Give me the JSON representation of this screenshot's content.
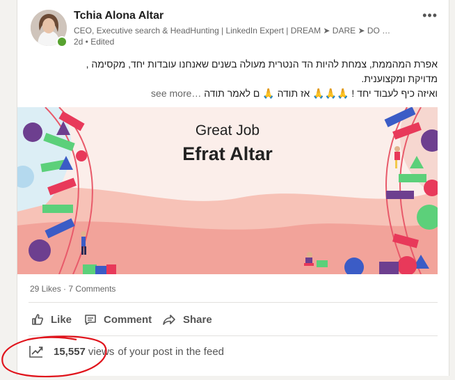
{
  "author": {
    "name": "Tchia Alona Altar",
    "headline": "CEO, Executive search & HeadHunting | LinkedIn Expert | DREAM ➤ DARE ➤ DO …",
    "meta": "2d • Edited"
  },
  "post": {
    "lines": [
      "אפרת המהממת, צמחת להיות הד הנטרית מעולה בשנים שאנחנו עובדות יחד, מקסימה ,",
      "מדויקת ומקצוענית.",
      "ואיזה כיף לעבוד יחד ! 🙏🙏🙏 אז תודה 🙏 ם לאמר תודה"
    ],
    "see_more": "…see more"
  },
  "image": {
    "subtitle": "Great Job",
    "title": "Efrat Altar"
  },
  "social": {
    "likes": "29 Likes",
    "separator": "·",
    "comments": "7 Comments"
  },
  "actions": {
    "like": "Like",
    "comment": "Comment",
    "share": "Share"
  },
  "analytics": {
    "views_count": "15,557",
    "views_word": "views",
    "views_suffix": "of your post in the feed"
  },
  "colors": {
    "annotation": "#e0141c",
    "accent_green": "#57a22f"
  }
}
